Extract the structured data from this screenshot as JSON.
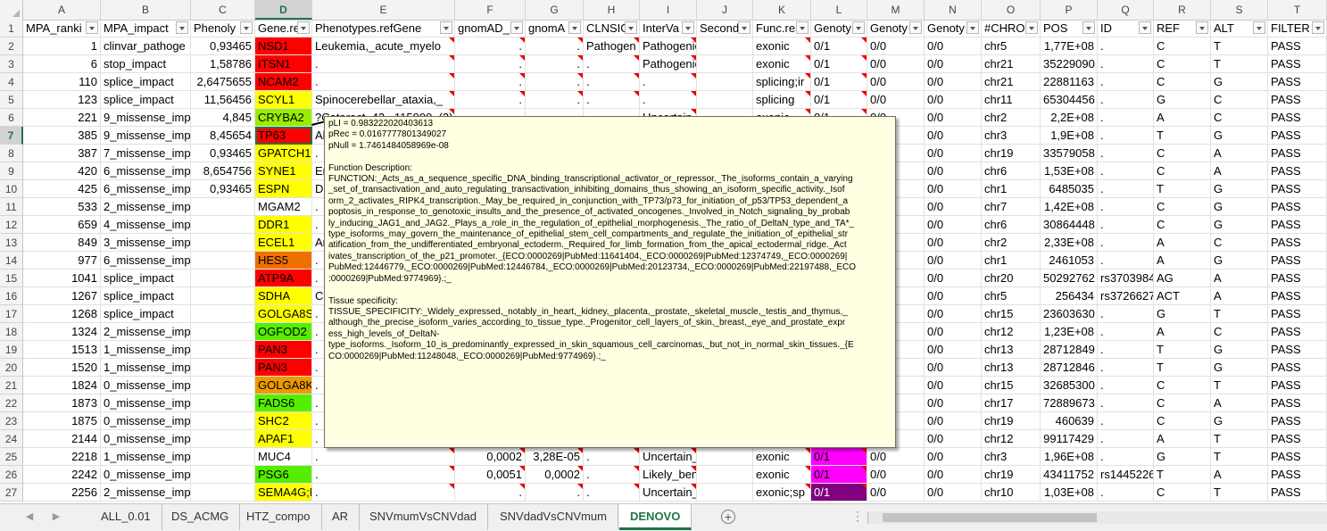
{
  "columns": [
    "A",
    "B",
    "C",
    "D",
    "E",
    "F",
    "G",
    "H",
    "I",
    "J",
    "K",
    "L",
    "M",
    "N",
    "O",
    "P",
    "Q",
    "R",
    "S",
    "T"
  ],
  "selected_column": "D",
  "selected_row": "7",
  "headers": [
    "MPA_ranki",
    "MPA_impact",
    "Phenoly",
    "Gene.re",
    "Phenotypes.refGene",
    "gnomAD_",
    "gnomA",
    "CLNSIG",
    "InterVa",
    "Second",
    "Func.re",
    "Genoty",
    "Genoty",
    "Genoty",
    "#CHRO",
    "POS",
    "ID",
    "REF",
    "ALT",
    "FILTER"
  ],
  "rows": [
    {
      "n": "2",
      "c": [
        "1",
        "clinvar_pathoge",
        "0,93465",
        "NSD1",
        "Leukemia,_acute_myelo",
        ".",
        ".",
        "Pathogen",
        "Pathogenic",
        "",
        "exonic",
        "0/1",
        "0/0",
        "0/0",
        "chr5",
        "1,77E+08",
        ".",
        "C",
        "T",
        "PASS"
      ]
    },
    {
      "n": "3",
      "c": [
        "6",
        "stop_impact",
        "1,58786",
        "ITSN1",
        ".",
        ".",
        ".",
        ".",
        "Pathogenic",
        "",
        "exonic",
        "0/1",
        "0/0",
        "0/0",
        "chr21",
        "35229090",
        ".",
        "C",
        "T",
        "PASS"
      ]
    },
    {
      "n": "4",
      "c": [
        "110",
        "splice_impact",
        "2,6475655",
        "NCAM2",
        ".",
        ".",
        ".",
        ".",
        ".",
        "",
        "splicing;ir",
        "0/1",
        "0/0",
        "0/0",
        "chr21",
        "22881163",
        ".",
        "C",
        "G",
        "PASS"
      ]
    },
    {
      "n": "5",
      "c": [
        "123",
        "splice_impact",
        "11,56456",
        "SCYL1",
        "Spinocerebellar_ataxia,_",
        ".",
        ".",
        ".",
        ".",
        "",
        "splicing",
        "0/1",
        "0/0",
        "0/0",
        "chr11",
        "65304456",
        ".",
        "G",
        "C",
        "PASS"
      ]
    },
    {
      "n": "6",
      "c": [
        "221",
        "9_missense_imp",
        "4,845",
        "CRYBA2",
        "?Cataract_42,_115900_(3)",
        "",
        "",
        "",
        "Uncertain_significan",
        "",
        "exonic",
        "0/1",
        "0/0",
        "0/0",
        "chr2",
        "2,2E+08",
        ".",
        "A",
        "C",
        "PASS"
      ]
    },
    {
      "n": "7",
      "c": [
        "385",
        "9_missense_imp",
        "8,45654",
        "TP63",
        "Al",
        "",
        "",
        "",
        "",
        "",
        "",
        "",
        "",
        "0/0",
        "chr3",
        "1,9E+08",
        ".",
        "T",
        "G",
        "PASS"
      ]
    },
    {
      "n": "8",
      "c": [
        "387",
        "7_missense_imp",
        "0,93465",
        "GPATCH1",
        ".",
        "",
        "",
        "",
        "",
        "",
        "",
        "",
        "",
        "0/0",
        "chr19",
        "33579058",
        ".",
        "C",
        "A",
        "PASS"
      ]
    },
    {
      "n": "9",
      "c": [
        "420",
        "6_missense_imp",
        "8,654756",
        "SYNE1",
        "Em",
        "",
        "",
        "",
        "",
        "",
        "",
        "",
        "",
        "0/0",
        "chr6",
        "1,53E+08",
        ".",
        "C",
        "A",
        "PASS"
      ]
    },
    {
      "n": "10",
      "c": [
        "425",
        "6_missense_imp",
        "0,93465",
        "ESPN",
        "De",
        "",
        "",
        "",
        "",
        "",
        "",
        "",
        "",
        "0/0",
        "chr1",
        "6485035",
        ".",
        "T",
        "G",
        "PASS"
      ]
    },
    {
      "n": "11",
      "c": [
        "533",
        "2_missense_impact",
        "",
        "MGAM2",
        ".",
        "",
        "",
        "",
        "",
        "",
        "",
        "",
        "",
        "0/0",
        "chr7",
        "1,42E+08",
        ".",
        "C",
        "G",
        "PASS"
      ]
    },
    {
      "n": "12",
      "c": [
        "659",
        "4_missense_impact",
        "",
        "DDR1",
        ".",
        "",
        "",
        "",
        "",
        "",
        "",
        "",
        "",
        "0/0",
        "chr6",
        "30864448",
        ".",
        "C",
        "G",
        "PASS"
      ]
    },
    {
      "n": "13",
      "c": [
        "849",
        "3_missense_impact",
        "",
        "ECEL1",
        "Ar",
        "",
        "",
        "",
        "",
        "",
        "",
        "",
        "",
        "0/0",
        "chr2",
        "2,33E+08",
        ".",
        "A",
        "C",
        "PASS"
      ]
    },
    {
      "n": "14",
      "c": [
        "977",
        "6_missense_impact",
        "",
        "HES5",
        ".",
        "",
        "",
        "",
        "",
        "",
        "",
        "",
        "",
        "0/0",
        "chr1",
        "2461053",
        ".",
        "A",
        "G",
        "PASS"
      ]
    },
    {
      "n": "15",
      "c": [
        "1041",
        "splice_impact",
        "",
        "ATP9A",
        ".",
        "",
        "",
        "",
        "",
        "",
        "",
        "",
        "",
        "0/0",
        "chr20",
        "50292762",
        "rs3703984",
        "AG",
        "A",
        "PASS"
      ]
    },
    {
      "n": "16",
      "c": [
        "1267",
        "splice_impact",
        "",
        "SDHA",
        "Ca",
        "",
        "",
        "",
        "",
        "",
        "",
        "",
        "",
        "0/0",
        "chr5",
        "256434",
        "rs3726627",
        "ACT",
        "A",
        "PASS"
      ]
    },
    {
      "n": "17",
      "c": [
        "1268",
        "splice_impact",
        "",
        "GOLGA8S",
        ".",
        "",
        "",
        "",
        "",
        "",
        "",
        "",
        "",
        "0/0",
        "chr15",
        "23603630",
        ".",
        "G",
        "T",
        "PASS"
      ]
    },
    {
      "n": "18",
      "c": [
        "1324",
        "2_missense_impact",
        "",
        "OGFOD2",
        ".",
        "",
        "",
        "",
        "",
        "",
        "",
        "",
        "",
        "0/0",
        "chr12",
        "1,23E+08",
        ".",
        "A",
        "C",
        "PASS"
      ]
    },
    {
      "n": "19",
      "c": [
        "1513",
        "1_missense_impact",
        "",
        "PAN3",
        ".",
        "",
        "",
        "",
        "",
        "",
        "",
        "",
        "",
        "0/0",
        "chr13",
        "28712849",
        ".",
        "T",
        "G",
        "PASS"
      ]
    },
    {
      "n": "20",
      "c": [
        "1520",
        "1_missense_impact",
        "",
        "PAN3",
        ".",
        "",
        "",
        "",
        "",
        "",
        "",
        "",
        "",
        "0/0",
        "chr13",
        "28712846",
        ".",
        "T",
        "G",
        "PASS"
      ]
    },
    {
      "n": "21",
      "c": [
        "1824",
        "0_missense_impact",
        "",
        "GOLGA8K",
        ".",
        "",
        "",
        "",
        "",
        "",
        "",
        "",
        "",
        "0/0",
        "chr15",
        "32685300",
        ".",
        "C",
        "T",
        "PASS"
      ]
    },
    {
      "n": "22",
      "c": [
        "1873",
        "0_missense_impact",
        "",
        "FADS6",
        ".",
        "",
        "",
        "",
        "",
        "",
        "",
        "",
        "",
        "0/0",
        "chr17",
        "72889673",
        ".",
        "C",
        "A",
        "PASS"
      ]
    },
    {
      "n": "23",
      "c": [
        "1875",
        "0_missense_impact",
        "",
        "SHC2",
        ".",
        "",
        "",
        "",
        "",
        "",
        "",
        "",
        "",
        "0/0",
        "chr19",
        "460639",
        ".",
        "C",
        "G",
        "PASS"
      ]
    },
    {
      "n": "24",
      "c": [
        "2144",
        "0_missense_impact",
        "",
        "APAF1",
        ".",
        "",
        "",
        "",
        "",
        "",
        "",
        "",
        "",
        "0/0",
        "chr12",
        "99117429",
        ".",
        "A",
        "T",
        "PASS"
      ]
    },
    {
      "n": "25",
      "c": [
        "2218",
        "1_missense_impact",
        "",
        "MUC4",
        ".",
        "0,0002",
        "3,28E-05",
        ".",
        "Uncertain_significan",
        "",
        "exonic",
        "0/1",
        "0/0",
        "0/0",
        "chr3",
        "1,96E+08",
        ".",
        "G",
        "T",
        "PASS"
      ]
    },
    {
      "n": "26",
      "c": [
        "2242",
        "0_missense_impact",
        "",
        "PSG6",
        ".",
        "0,0051",
        "0,0002",
        ".",
        "Likely_benign",
        "",
        "exonic",
        "0/1",
        "0/0",
        "0/0",
        "chr19",
        "43411752",
        "rs1445226",
        "T",
        "A",
        "PASS"
      ]
    },
    {
      "n": "27",
      "c": [
        "2256",
        "2_missense_impact",
        "",
        "SEMA4G;N",
        ".",
        ".",
        ".",
        ".",
        "Uncertain_significan",
        "",
        "exonic;sp",
        "0/1",
        "0/0",
        "0/0",
        "chr10",
        "1,03E+08",
        ".",
        "C",
        "T",
        "PASS"
      ]
    }
  ],
  "gene_colors": [
    "#ff0000",
    "#ff0000",
    "#ff0000",
    "#ffff00",
    "#99ee00",
    "#ff0000",
    "#ffff00",
    "#ffff00",
    "#ffff00",
    "#ffffff",
    "#ffff00",
    "#ffff00",
    "#ee7000",
    "#ff0000",
    "#ffff00",
    "#ffff00",
    "#55ee00",
    "#ff0000",
    "#ff0000",
    "#ee9900",
    "#55ee00",
    "#ffff00",
    "#ffff00",
    "#ffffff",
    "#55ee00",
    "#ffff00"
  ],
  "genotype_colors": {
    "25": "#ff00ff",
    "26": "#ff00ff",
    "27": "#800080"
  },
  "comment_lines": [
    "pLI = 0.983222020403613",
    "pRec = 0.0167777801349027",
    "pNull = 1.7461484058969e-08",
    "",
    "Function Description:",
    "FUNCTION:_Acts_as_a_sequence_specific_DNA_binding_transcriptional_activator_or_repressor._The_isoforms_contain_a_varying",
    "_set_of_transactivation_and_auto_regulating_transactivation_inhibiting_domains_thus_showing_an_isoform_specific_activity._Isof",
    "orm_2_activates_RIPK4_transcription._May_be_required_in_conjunction_with_TP73/p73_for_initiation_of_p53/TP53_dependent_a",
    "poptosis_in_response_to_genotoxic_insults_and_the_presence_of_activated_oncogenes._Involved_in_Notch_signaling_by_probab",
    "ly_inducing_JAG1_and_JAG2._Plays_a_role_in_the_regulation_of_epithelial_morphogenesis._The_ratio_of_DeltaN_type_and_TA*_",
    "type_isoforms_may_govern_the_maintenance_of_epithelial_stem_cell_compartments_and_regulate_the_initiation_of_epithelial_str",
    "atification_from_the_undifferentiated_embryonal_ectoderm._Required_for_limb_formation_from_the_apical_ectodermal_ridge._Act",
    "ivates_transcription_of_the_p21_promoter._{ECO:0000269|PubMed:11641404,_ECO:0000269|PubMed:12374749,_ECO:0000269|",
    "PubMed:12446779,_ECO:0000269|PubMed:12446784,_ECO:0000269|PubMed:20123734,_ECO:0000269|PubMed:22197488,_ECO",
    ":0000269|PubMed:9774969}.;_",
    "",
    "Tissue specificity:",
    "TISSUE_SPECIFICITY:_Widely_expressed,_notably_in_heart,_kidney,_placenta,_prostate,_skeletal_muscle,_testis_and_thymus,_",
    "although_the_precise_isoform_varies_according_to_tissue_type._Progenitor_cell_layers_of_skin,_breast,_eye_and_prostate_expr",
    "ess_high_levels_of_DeltaN-",
    "type_isoforms._Isoform_10_is_predominantly_expressed_in_skin_squamous_cell_carcinomas,_but_not_in_normal_skin_tissues._{E",
    "CO:0000269|PubMed:11248048,_ECO:0000269|PubMed:9774969}.;_"
  ],
  "tabs": [
    "ALL_0.01",
    "DS_ACMG",
    "HTZ_compo",
    "AR",
    "SNVmumVsCNVdad",
    "SNVdadVsCNVmum",
    "DENOVO"
  ],
  "active_tab": "DENOVO",
  "add_sheet_label": "+",
  "nav_prev": "◀",
  "nav_next": "▶",
  "more_dots": "⋮"
}
